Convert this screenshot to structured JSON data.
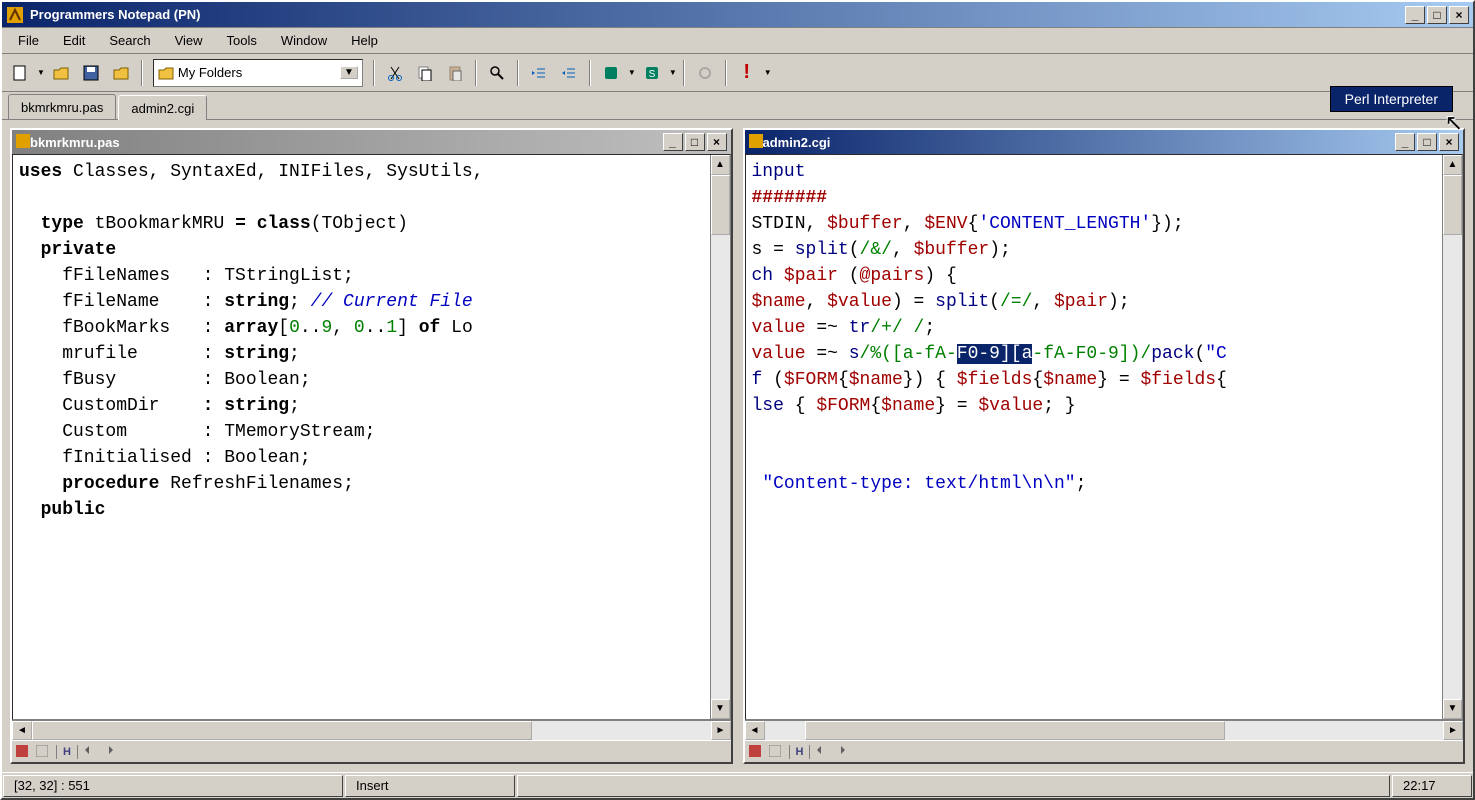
{
  "app": {
    "title": "Programmers Notepad (PN)"
  },
  "menu": {
    "items": [
      "File",
      "Edit",
      "Search",
      "View",
      "Tools",
      "Window",
      "Help"
    ]
  },
  "toolbar": {
    "folder_combo": "My Folders"
  },
  "tooltip": {
    "text": "Perl Interpreter"
  },
  "tabs": {
    "items": [
      {
        "label": "bkmrkmru.pas",
        "active": false
      },
      {
        "label": "admin2.cgi",
        "active": true
      }
    ]
  },
  "child_windows": [
    {
      "title": "bkmrkmru.pas",
      "active": false,
      "content_html": "<span class='kw'>uses</span> Classes, SyntaxEd, INIFiles, SysUtils,\n\n  <span class='kw'>type</span> tBookmarkMRU <span class='kw'>=</span> <span class='kw'>class</span>(TObject)\n  <span class='kw'>private</span>\n    fFileNames   : TStringList;\n    fFileName    : <span class='kw'>string</span>; <span class='cm'>// Current File</span>\n    fBookMarks   : <span class='kw'>array</span>[<span class='num'>0</span>..<span class='num'>9</span>, <span class='num'>0</span>..<span class='num'>1</span>] <span class='kw'>of</span> Lo\n    mrufile      : <span class='kw'>string</span>;\n    fBusy        : Boolean;\n    CustomDir    <span class='kw'>:</span> <span class='kw'>string</span>;\n    Custom       : TMemoryStream;\n    fInitialised : Boolean;\n    <span class='kw'>procedure</span> RefreshFilenames;\n  <span class='kw'>public</span>"
    },
    {
      "title": "admin2.cgi",
      "active": true,
      "content_html": "<span class='pl-kw'>input</span>\n<span class='pl-cm'>#######</span>\nSTDIN, <span class='pl-var'>$buffer</span>, <span class='pl-var'>$ENV</span>{<span class='pl-q'>'CONTENT_LENGTH'</span>});\ns = <span class='pl-kw'>split</span>(<span class='pl-re'>/&/</span>, <span class='pl-var'>$buffer</span>);\n<span class='pl-kw'>ch</span> <span class='pl-var'>$pair</span> (<span class='pl-var'>@pairs</span>) {\n<span class='pl-var'>$name</span>, <span class='pl-var'>$value</span>) = <span class='pl-kw'>split</span>(<span class='pl-re'>/=/</span>, <span class='pl-var'>$pair</span>);\n<span class='pl-var'>value</span> =~ <span class='pl-kw'>tr</span><span class='pl-re'>/+/ /</span>;\n<span class='pl-var'>value</span> =~ <span class='pl-kw'>s</span><span class='pl-re'>/%([a-fA-</span><span class='sel'>F0-9][a</span><span class='pl-re'>-fA-F0-9])/</span><span class='pl-kw'>pack</span>(<span class='pl-q'>\"C</span>\n<span class='pl-kw'>f</span> (<span class='pl-var'>$FORM</span>{<span class='pl-var'>$name</span>}) { <span class='pl-var'>$fields</span>{<span class='pl-var'>$name</span>} = <span class='pl-var'>$fields</span>{\n<span class='pl-kw'>lse</span> { <span class='pl-var'>$FORM</span>{<span class='pl-var'>$name</span>} = <span class='pl-var'>$value</span>; }\n\n\n <span class='pl-q'>\"Content-type: text/html\\n\\n\"</span>;"
    }
  ],
  "status": {
    "pos": "[32, 32] : 551",
    "mode": "Insert",
    "time": "22:17"
  }
}
